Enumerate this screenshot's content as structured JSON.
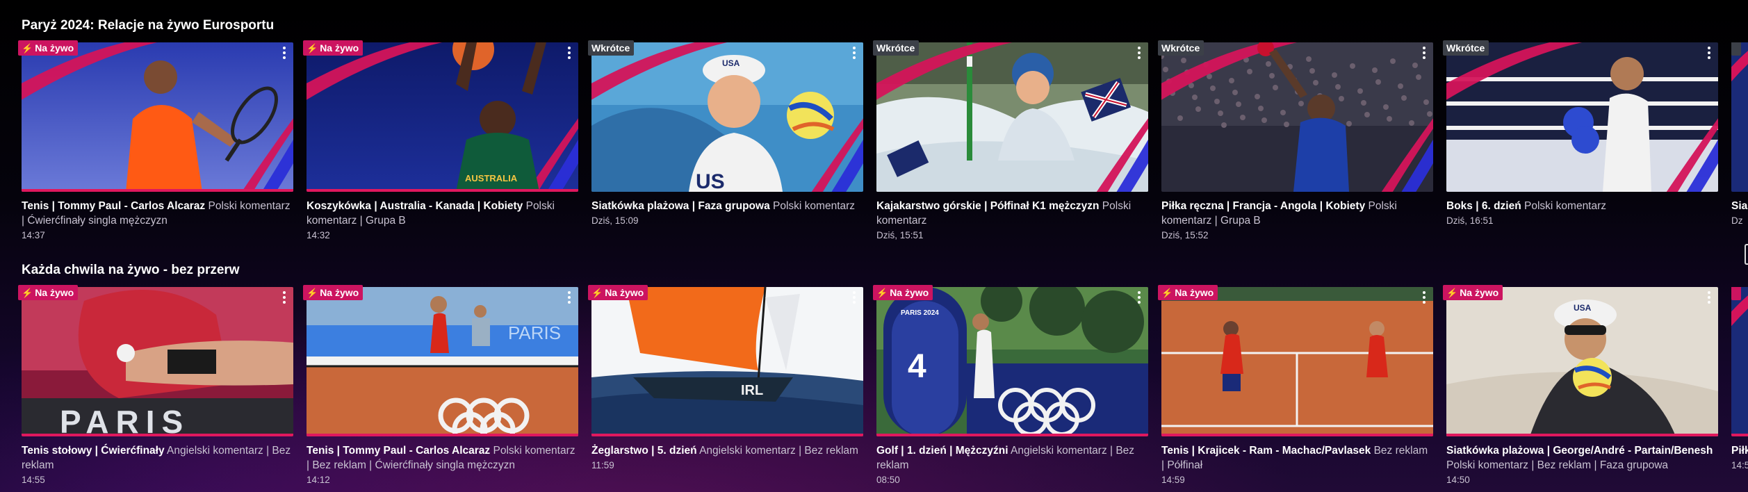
{
  "rails": [
    {
      "title": "Paryż 2024: Relacje na żywo Eurosportu",
      "cards": [
        {
          "badge": "Na żywo",
          "badge_kind": "live",
          "title": "Tenis | Tommy Paul - Carlos Alcaraz",
          "subtitle": " Polski komentarz | Ćwierćfinały singla mężczyzn",
          "time": "14:37",
          "progress": 1.0,
          "scene": "tennis-player"
        },
        {
          "badge": "Na żywo",
          "badge_kind": "live",
          "title": "Koszykówka | Australia - Kanada | Kobiety",
          "subtitle": " Polski komentarz | Grupa B",
          "time": "14:32",
          "progress": 1.0,
          "scene": "basketball"
        },
        {
          "badge": "Wkrótce",
          "badge_kind": "soon",
          "title": "Siatkówka plażowa | Faza grupowa",
          "subtitle": " Polski komentarz",
          "time": "Dziś, 15:09",
          "progress": 0,
          "scene": "beach-volley"
        },
        {
          "badge": "Wkrótce",
          "badge_kind": "soon",
          "title": "Kajakarstwo górskie | Półfinał K1 mężczyzn",
          "subtitle": " Polski komentarz",
          "time": "Dziś, 15:51",
          "progress": 0,
          "scene": "canoe"
        },
        {
          "badge": "Wkrótce",
          "badge_kind": "soon",
          "title": "Piłka ręczna | Francja - Angola | Kobiety",
          "subtitle": " Polski komentarz | Grupa B",
          "time": "Dziś, 15:52",
          "progress": 0,
          "scene": "handball"
        },
        {
          "badge": "Wkrótce",
          "badge_kind": "soon",
          "title": "Boks | 6. dzień",
          "subtitle": " Polski komentarz",
          "time": "Dziś, 16:51",
          "progress": 0,
          "scene": "boxing"
        },
        {
          "badge": "",
          "badge_kind": "soon",
          "title": "Sia",
          "subtitle": "",
          "time": "Dz",
          "progress": 0,
          "scene": "peek"
        }
      ]
    },
    {
      "title": "Każda chwila na żywo - bez przerw",
      "cards": [
        {
          "badge": "Na żywo",
          "badge_kind": "live",
          "title": "Tenis stołowy | Ćwierćfinały",
          "subtitle": " Angielski komentarz | Bez reklam",
          "time": "14:55",
          "progress": 1.0,
          "scene": "table-tennis"
        },
        {
          "badge": "Na żywo",
          "badge_kind": "live",
          "title": "Tenis | Tommy Paul - Carlos Alcaraz",
          "subtitle": " Polski komentarz | Bez reklam | Ćwierćfinały singla mężczyzn",
          "time": "14:12",
          "progress": 1.0,
          "scene": "tennis-court"
        },
        {
          "badge": "Na żywo",
          "badge_kind": "live",
          "title": "Żeglarstwo | 5. dzień",
          "subtitle": " Angielski komentarz | Bez reklam",
          "time": "11:59",
          "progress": 1.0,
          "scene": "sailing"
        },
        {
          "badge": "Na żywo",
          "badge_kind": "live",
          "title": "Golf | 1. dzień | Mężczyźni",
          "subtitle": " Angielski komentarz | Bez reklam",
          "time": "08:50",
          "progress": 1.0,
          "scene": "golf"
        },
        {
          "badge": "Na żywo",
          "badge_kind": "live",
          "title": "Tenis | Krajicek - Ram - Machac/Pavlasek",
          "subtitle": " Bez reklam | Półfinał",
          "time": "14:59",
          "progress": 1.0,
          "scene": "clay-tennis"
        },
        {
          "badge": "Na żywo",
          "badge_kind": "live",
          "title": "Siatkówka plażowa | George/André - Partain/Benesh",
          "subtitle": " Polski komentarz | Bez reklam | Faza grupowa",
          "time": "14:50",
          "progress": 1.0,
          "scene": "beach-dive"
        },
        {
          "badge": "",
          "badge_kind": "live",
          "title": "Piłk",
          "subtitle": "",
          "time": "14:5",
          "progress": 1.0,
          "scene": "peek"
        }
      ]
    }
  ],
  "overlay_text": {
    "paris": "PARIS",
    "paris_small": "PARIS",
    "usa": "USA",
    "australia": "AUSTRALIA"
  },
  "colors": {
    "live_badge": "#cc1460",
    "soon_badge": "#3c4048",
    "progress": "#e0185e",
    "accent_stripe": "#d4145a",
    "accent_blue": "#2b2fd8"
  }
}
